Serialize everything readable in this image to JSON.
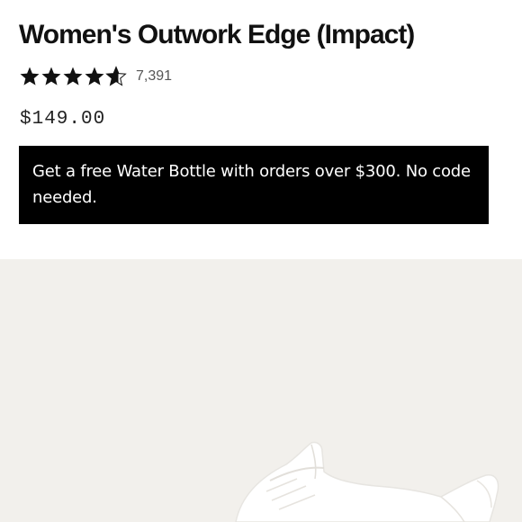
{
  "product": {
    "title": "Women's Outwork Edge (Impact)",
    "rating": 4.6,
    "review_count": "7,391",
    "price": "$149.00"
  },
  "promo": {
    "text": "Get a free Water Bottle with orders over $300. No code needed."
  },
  "gallery": {
    "image_icon": "sneaker-photo"
  },
  "colors": {
    "text": "#111111",
    "banner_bg": "#000000",
    "banner_text": "#ffffff",
    "gallery_bg": "#f2f0ec"
  }
}
